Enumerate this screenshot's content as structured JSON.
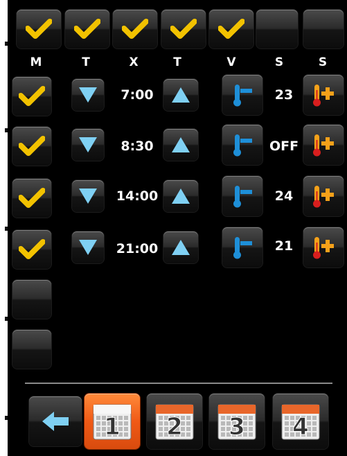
{
  "days_header": {
    "labels": [
      "M",
      "T",
      "X",
      "T",
      "V",
      "S",
      "S"
    ],
    "checked": [
      true,
      true,
      true,
      true,
      true,
      false,
      false
    ]
  },
  "schedule": {
    "rows": [
      {
        "enabled": true,
        "time": "7:00",
        "temp": "23"
      },
      {
        "enabled": true,
        "time": "8:30",
        "temp": "OFF"
      },
      {
        "enabled": true,
        "time": "14:00",
        "temp": "24"
      },
      {
        "enabled": true,
        "time": "21:00",
        "temp": "21"
      },
      {
        "enabled": false
      },
      {
        "enabled": false
      }
    ]
  },
  "bottom_nav": {
    "pages": [
      "1",
      "2",
      "3",
      "4"
    ],
    "active_page": "1"
  },
  "colors": {
    "check": "#f2c200",
    "arrow": "#7fd0f3",
    "thermo_blue": "#1e8fd8",
    "thermo_orange": "#f5a11a",
    "calendar_orange": "#e8662a"
  },
  "icons": {
    "check": "check-icon",
    "decrease": "arrow-down-icon",
    "increase": "arrow-up-icon",
    "temp_down": "thermometer-decrease-icon",
    "temp_up": "thermometer-increase-icon",
    "back": "arrow-left-icon",
    "calendar": "calendar-icon"
  }
}
